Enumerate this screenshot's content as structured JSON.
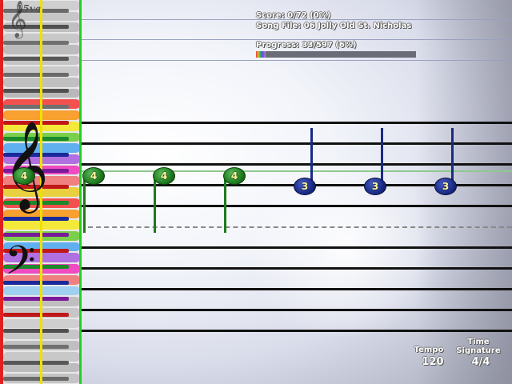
{
  "hud": {
    "score": "Score: 0/72 (0%)",
    "song_file": "Song File: 06 Jolly Old St. Nicholas",
    "progress_text": "Progress: 33/597 (6%)",
    "progress_fraction": 0.06
  },
  "clefs": {
    "octave_label": "15va",
    "octave_clef_icon": "treble-clef-icon",
    "treble_icon": "treble-clef-icon",
    "bass_icon": "bass-clef-icon"
  },
  "notes": [
    {
      "finger": "4",
      "color": "green"
    },
    {
      "finger": "4",
      "color": "green"
    },
    {
      "finger": "4",
      "color": "green"
    },
    {
      "finger": "3",
      "color": "blue"
    },
    {
      "finger": "3",
      "color": "blue"
    },
    {
      "finger": "3",
      "color": "blue"
    }
  ],
  "footer": {
    "tempo_label": "Tempo",
    "tempo_value": "120",
    "time_sig_label_1": "Time",
    "time_sig_label_2": "Signature",
    "time_sig_value": "4/4"
  },
  "colors": {
    "left_marker": "#e02020",
    "center_marker": "#f0e000",
    "play_line": "#20d020",
    "green_note": "#1e7a1e",
    "blue_note": "#1a2a86"
  }
}
